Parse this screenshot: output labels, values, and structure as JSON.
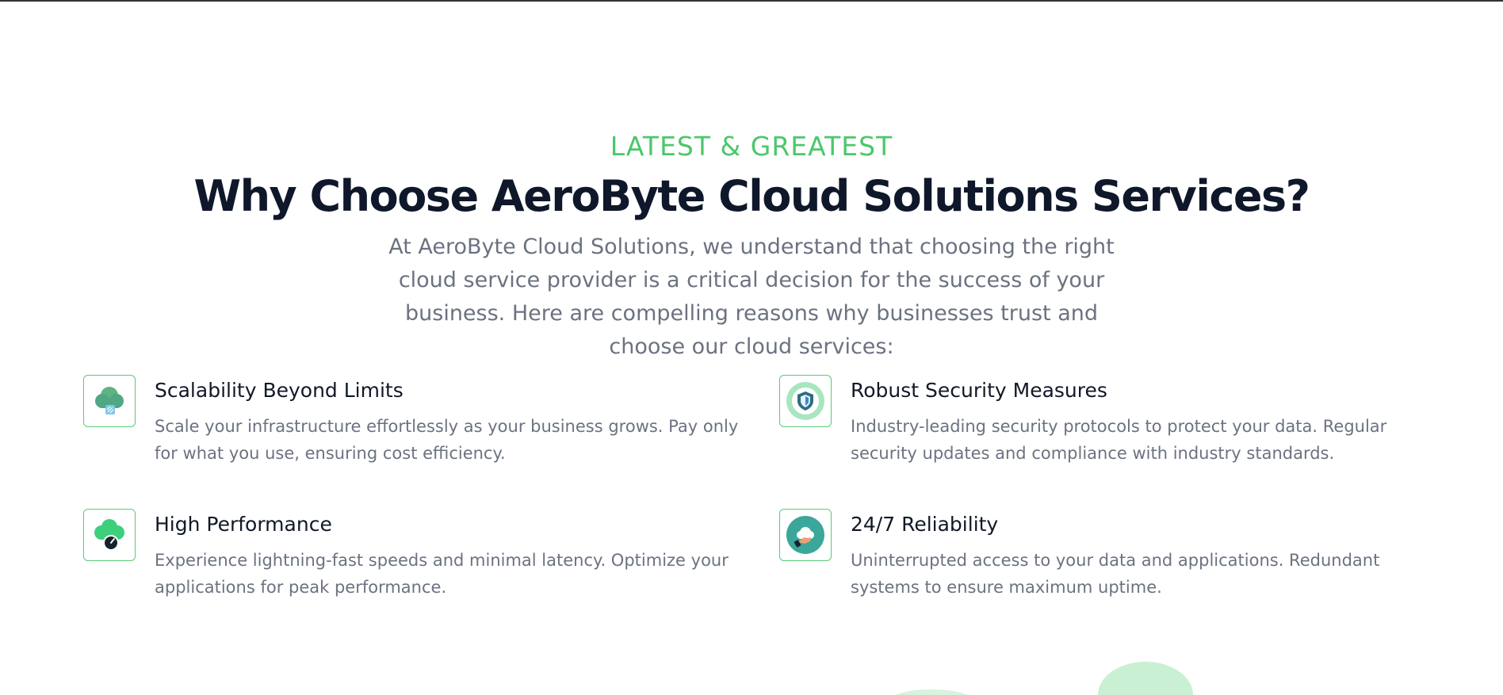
{
  "section": {
    "eyebrow": "LATEST & GREATEST",
    "title": "Why Choose AeroByte Cloud Solutions Services?",
    "intro": "At AeroByte Cloud Solutions, we understand that choosing the right cloud service provider is a critical decision for the success of your business. Here are compelling reasons why businesses trust and choose our cloud services:"
  },
  "features": [
    {
      "title": "Scalability Beyond Limits",
      "description": "Scale your infrastructure effortlessly as your business grows. Pay only for what you use, ensuring cost efficiency.",
      "icon": "cloud-scale-icon"
    },
    {
      "title": "Robust Security Measures",
      "description": "Industry-leading security protocols to protect your data. Regular security updates and compliance with industry standards.",
      "icon": "shield-icon"
    },
    {
      "title": "High Performance",
      "description": "Experience lightning-fast speeds and minimal latency. Optimize your applications for peak performance.",
      "icon": "cloud-speed-icon"
    },
    {
      "title": "24/7 Reliability",
      "description": "Uninterrupted access to your data and applications. Redundant systems to ensure maximum uptime.",
      "icon": "cloud-hand-icon"
    }
  ],
  "colors": {
    "accent": "#4cc76a",
    "heading": "#0f172a",
    "body_text": "#6b7280",
    "icon_border": "#5cc978",
    "decor": "#c9f0d3"
  }
}
